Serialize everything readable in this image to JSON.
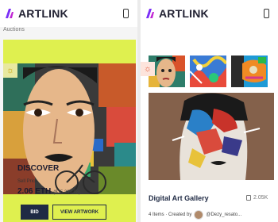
{
  "brand": "ARTLINK",
  "left_screen": {
    "breadcrumb": "Auctions",
    "featured": {
      "title": "DISCOVER",
      "sell_price_label": "Sell Price",
      "price_eth": "2.06 ETH",
      "price_usd": "($15,237.08)",
      "bid_label": "BID",
      "view_label": "VIEW ARTWORK"
    }
  },
  "right_screen": {
    "gallery": {
      "title": "Digital Art Gallery",
      "likes": "2.05K",
      "items_created": "4 Items · Created by",
      "creator": "@Dezy_resato..."
    }
  },
  "colors": {
    "accent_lime": "#dff04f",
    "navy": "#1f2a44",
    "brand_purple": "#8b3dff"
  },
  "icons": [
    "artlink-logo-icon",
    "phone-icon",
    "sun-icon",
    "copy-icon",
    "avatar"
  ]
}
